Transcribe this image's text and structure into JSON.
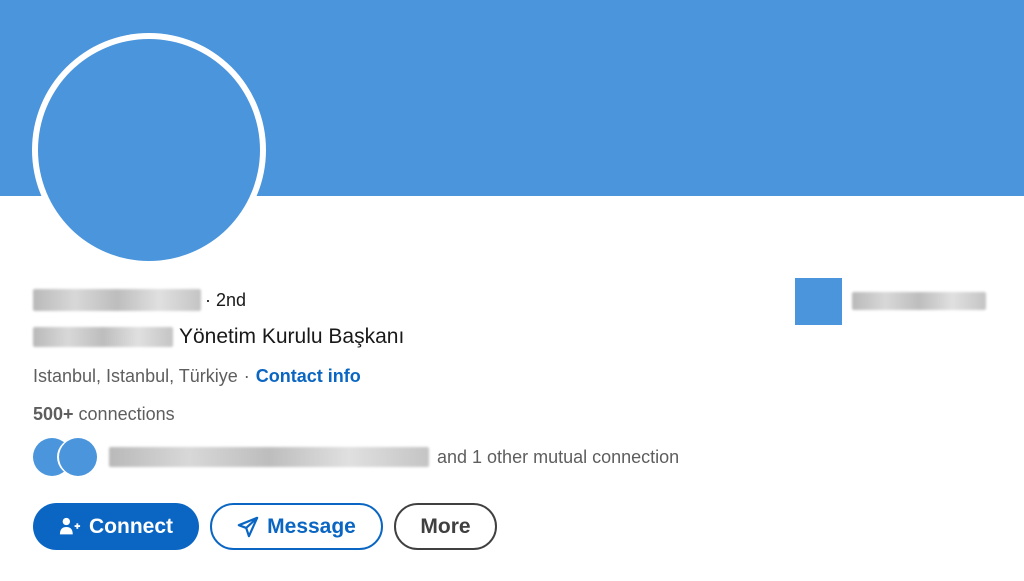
{
  "profile": {
    "degree": "· 2nd",
    "headline": "Yönetim Kurulu Başkanı",
    "location": "Istanbul, Istanbul, Türkiye",
    "separator": "·",
    "contact_info": "Contact info",
    "connections_count": "500+",
    "connections_label": "connections",
    "mutual_text": "and 1 other mutual connection"
  },
  "actions": {
    "connect_label": "Connect",
    "message_label": "Message",
    "more_label": "More"
  },
  "icons": {
    "connect": "add-person-icon",
    "message": "send-icon"
  },
  "colors": {
    "banner": "#4a95dc",
    "primary": "#0a66c2",
    "text": "#191919",
    "muted": "#5e5e5e"
  }
}
